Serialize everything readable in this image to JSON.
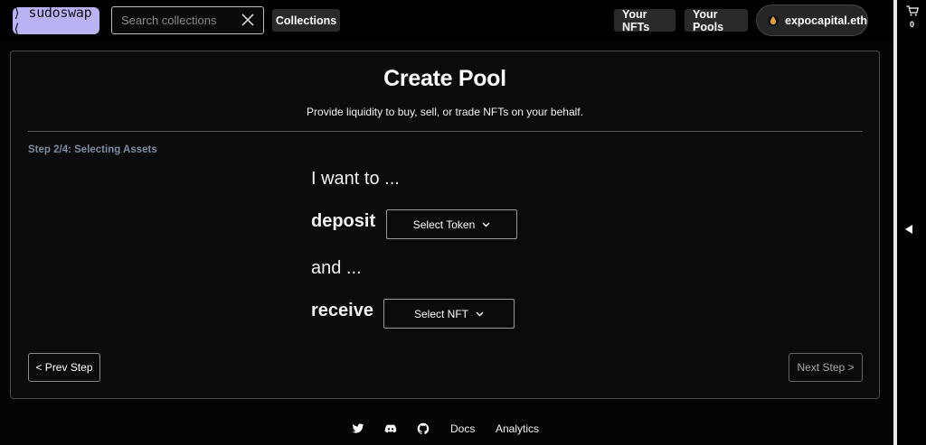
{
  "header": {
    "logo_text": "⟩ sudoswap ⟨",
    "search_placeholder": "Search collections",
    "collections_label": "Collections",
    "your_nfts_label": "Your NFTs",
    "your_pools_label": "Your Pools",
    "wallet_name": "expocapital.eth"
  },
  "sidebar": {
    "cart_count": "0"
  },
  "card": {
    "title": "Create Pool",
    "subtitle": "Provide liquidity to buy, sell, or trade NFTs on your behalf.",
    "step_label": "Step 2/4: Selecting Assets",
    "i_want_to": "I want to ...",
    "deposit": "deposit",
    "select_token": "Select Token",
    "and": "and ...",
    "receive": "receive",
    "select_nft": "Select NFT",
    "prev_step": "< Prev Step",
    "next_step": "Next Step >"
  },
  "footer": {
    "docs": "Docs",
    "analytics": "Analytics"
  },
  "colors": {
    "logo_bg": "#b9b2f5",
    "step_label": "#7c8ba1",
    "background": "#050505"
  }
}
